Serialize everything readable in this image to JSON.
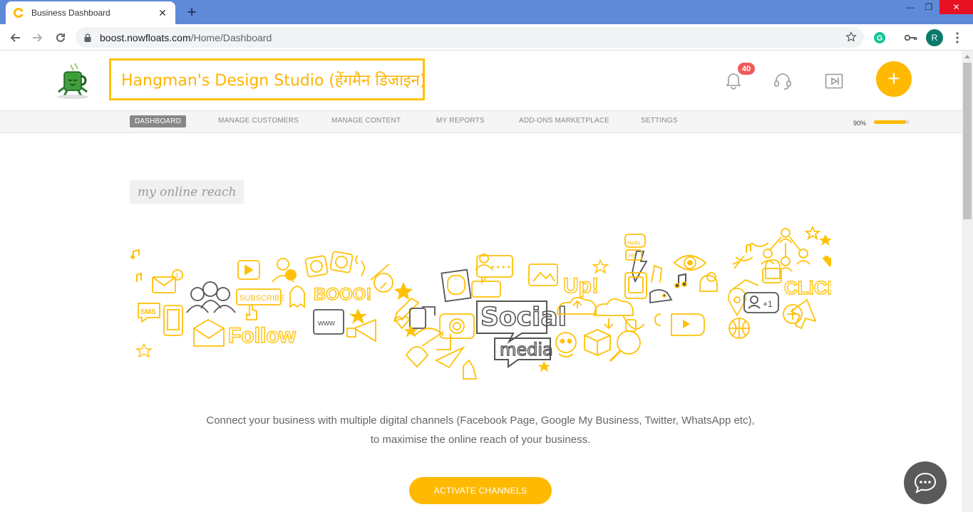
{
  "browser": {
    "tab_title": "Business Dashboard",
    "new_tab_label": "+",
    "url_host": "boost.nowfloats.com",
    "url_path": "/Home/Dashboard",
    "profile_initial": "R"
  },
  "header": {
    "business_name": "Hangman's Design Studio (हेंगमैन डिजाइन)",
    "notification_count": "40",
    "add_label": "+"
  },
  "nav": {
    "items": [
      {
        "label": "DASHBOARD",
        "active": true
      },
      {
        "label": "MANAGE CUSTOMERS"
      },
      {
        "label": "MANAGE CONTENT"
      },
      {
        "label": "MY REPORTS"
      },
      {
        "label": "ADD-ONS MARKETPLACE"
      },
      {
        "label": "SETTINGS"
      }
    ],
    "profile_progress_label": "90%",
    "profile_progress": 0.9
  },
  "main": {
    "section_label": "my online reach",
    "illustration": {
      "texts": [
        "SMS",
        "Follow",
        "SUBSCRIBE",
        "BOOO!",
        "www",
        "Social",
        "media",
        "Up!",
        "Hello",
        "Hi!",
        "CLiCK",
        "+1"
      ]
    },
    "description_line1": "Connect your business with multiple digital channels (Facebook Page, Google My Business, Twitter, WhatsApp etc),",
    "description_line2": "to maximise the online reach of your business.",
    "cta_label": "ACTIVATE CHANNELS"
  },
  "colors": {
    "accent": "#ffb900",
    "titlebar": "#5e8ad8",
    "badge": "#f05a5a"
  }
}
